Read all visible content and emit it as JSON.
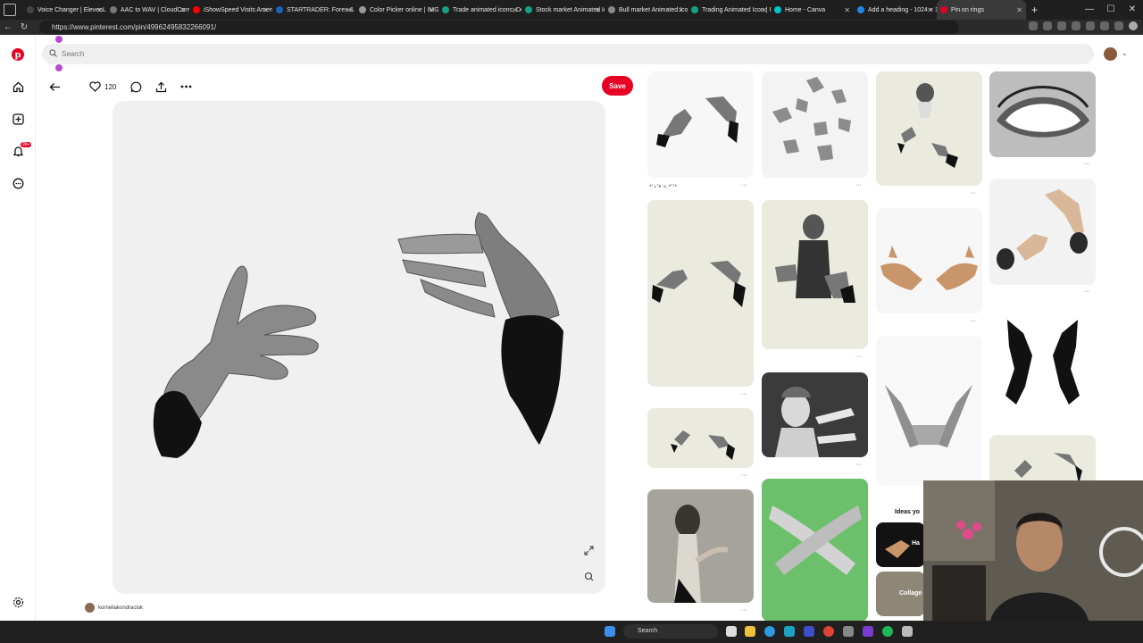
{
  "browser": {
    "tabs": [
      {
        "title": "Voice Changer | ElevenLabs",
        "color": "#444444"
      },
      {
        "title": "AAC to WAV | CloudConvert",
        "color": "#777777"
      },
      {
        "title": "iShowSpeed Visits America",
        "color": "#ff0000"
      },
      {
        "title": "STARTRADER: Forex & CFD",
        "color": "#1565c0"
      },
      {
        "title": "Color Picker online | IMG",
        "color": "#999999"
      },
      {
        "title": "Trade animated icons, Des",
        "color": "#16a085"
      },
      {
        "title": "Stock market Animated Ico",
        "color": "#16a085"
      },
      {
        "title": "Bull market Animated Icon",
        "color": "#888888"
      },
      {
        "title": "Trading Animated Icon | F",
        "color": "#16a085"
      },
      {
        "title": "Home - Canva",
        "color": "#00c4cc"
      },
      {
        "title": "Add a heading - 1024 × 1",
        "color": "#1e88e5"
      },
      {
        "title": "Pin on rings",
        "color": "#e60023",
        "active": true
      }
    ],
    "url": "https://www.pinterest.com/pin/49962495832266091/"
  },
  "search": {
    "placeholder": "Search"
  },
  "notifications_badge": "99+",
  "pin": {
    "like_count": "120",
    "save_label": "Save",
    "creator": "korneliakondracluk"
  },
  "grid": {
    "first_caption": "*ᐟ⋆˚࿔ ✧.*˚ᐟ*",
    "ideas_heading": "Ideas yo",
    "chip_1": "Ha",
    "chip_2": "Collage"
  },
  "taskbar": {
    "search_label": "Search"
  },
  "colors": {
    "brand": "#e60023",
    "green_card": "#6cc06b",
    "cream_card": "#ebeadf"
  }
}
